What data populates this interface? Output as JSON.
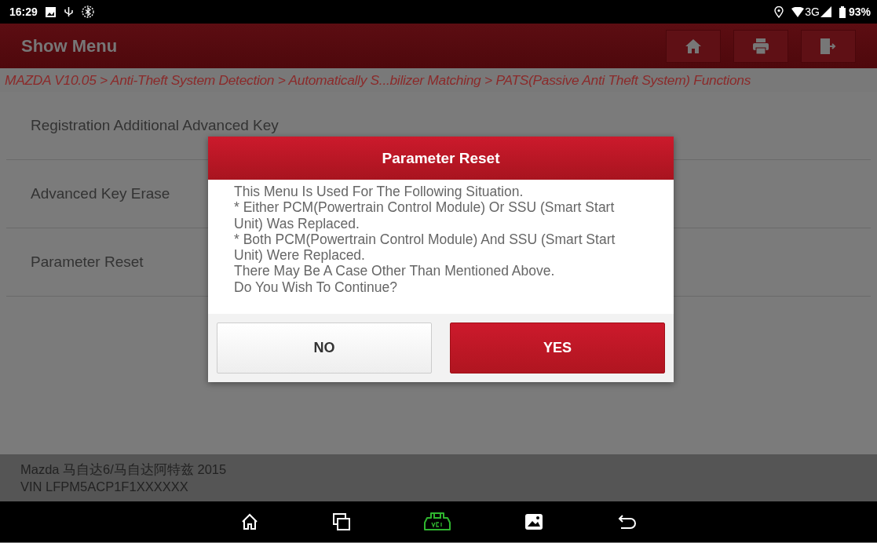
{
  "status_bar": {
    "time": "16:29",
    "network": "3G",
    "battery": "93%"
  },
  "header": {
    "title": "Show Menu"
  },
  "breadcrumb": "MAZDA V10.05 > Anti-Theft System Detection > Automatically S...bilizer Matching > PATS(Passive Anti Theft System) Functions",
  "menu_items": [
    "Registration Additional Advanced Key",
    "Advanced Key Erase",
    "Parameter Reset"
  ],
  "dialog": {
    "title": "Parameter Reset",
    "message": [
      "This Menu Is Used For The Following Situation.",
      "* Either PCM(Powertrain Control Module) Or SSU (Smart Start Unit) Was Replaced.",
      "* Both PCM(Powertrain Control Module) And SSU (Smart Start Unit) Were Replaced.",
      "There May Be A Case Other Than Mentioned Above.",
      "Do You Wish To Continue?"
    ],
    "buttons": [
      {
        "label": "NO",
        "kind": "secondary"
      },
      {
        "label": "YES",
        "kind": "primary"
      }
    ]
  },
  "vehicle": {
    "model": "Mazda 马自达6/马自达阿特兹 2015",
    "vin": "VIN LFPM5ACP1F1XXXXXX"
  }
}
